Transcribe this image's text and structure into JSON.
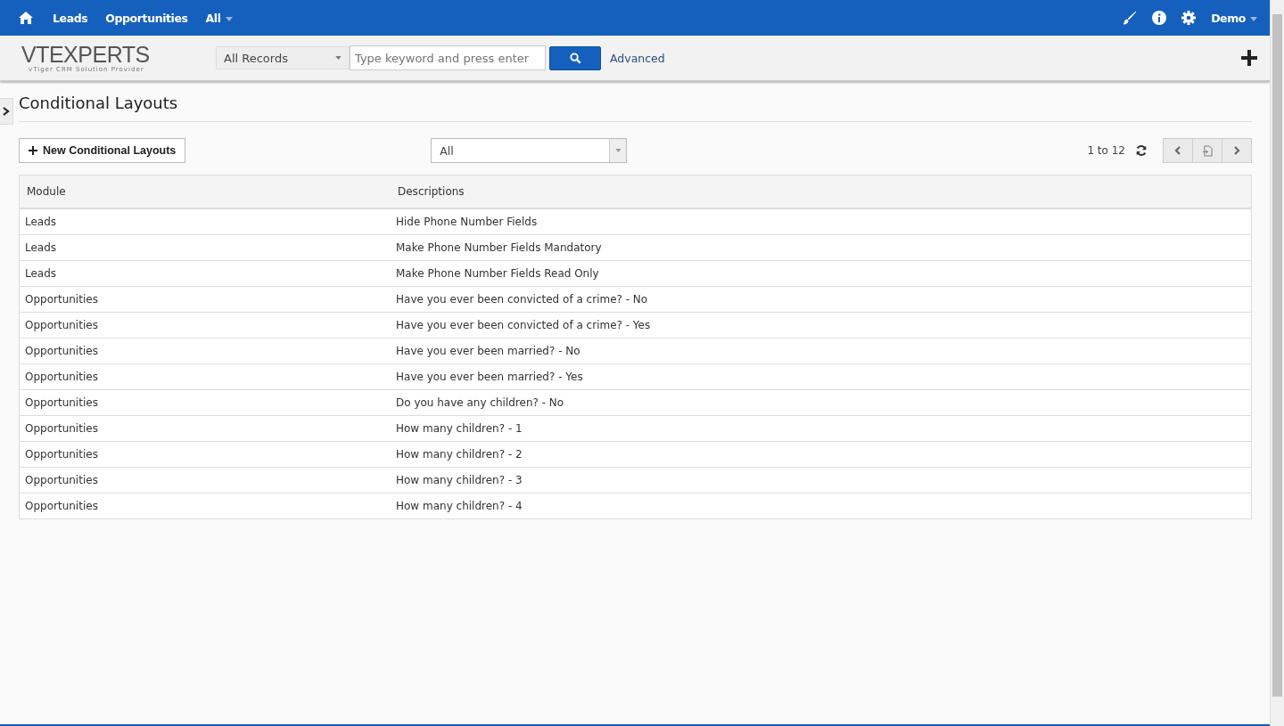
{
  "top_nav": {
    "items": [
      {
        "label": "Leads",
        "dropdown": false
      },
      {
        "label": "Opportunities",
        "dropdown": false
      },
      {
        "label": "All",
        "dropdown": true
      }
    ],
    "user": "Demo"
  },
  "header": {
    "logo": {
      "text": "VTEXPERTS",
      "tagline": "vTiger CRM Solution Provider"
    },
    "search_scope": "All Records",
    "search": {
      "placeholder": "Type keyword and press enter"
    },
    "advanced_link": "Advanced"
  },
  "page_title": "Conditional Layouts",
  "new_button": "New Conditional Layouts",
  "filter": {
    "value": "All"
  },
  "pagination": {
    "range": "1 to 12"
  },
  "table": {
    "columns": [
      "Module",
      "Descriptions"
    ],
    "rows": [
      [
        "Leads",
        "Hide Phone Number Fields"
      ],
      [
        "Leads",
        "Make Phone Number Fields Mandatory"
      ],
      [
        "Leads",
        "Make Phone Number Fields Read Only"
      ],
      [
        "Opportunities",
        "Have you ever been convicted of a crime? - No"
      ],
      [
        "Opportunities",
        "Have you ever been convicted of a crime? - Yes"
      ],
      [
        "Opportunities",
        "Have you ever been married? - No"
      ],
      [
        "Opportunities",
        "Have you ever been married? - Yes"
      ],
      [
        "Opportunities",
        "Do you have any children? - No"
      ],
      [
        "Opportunities",
        "How many children? - 1"
      ],
      [
        "Opportunities",
        "How many children? - 2"
      ],
      [
        "Opportunities",
        "How many children? - 3"
      ],
      [
        "Opportunities",
        "How many children? - 4"
      ]
    ]
  }
}
